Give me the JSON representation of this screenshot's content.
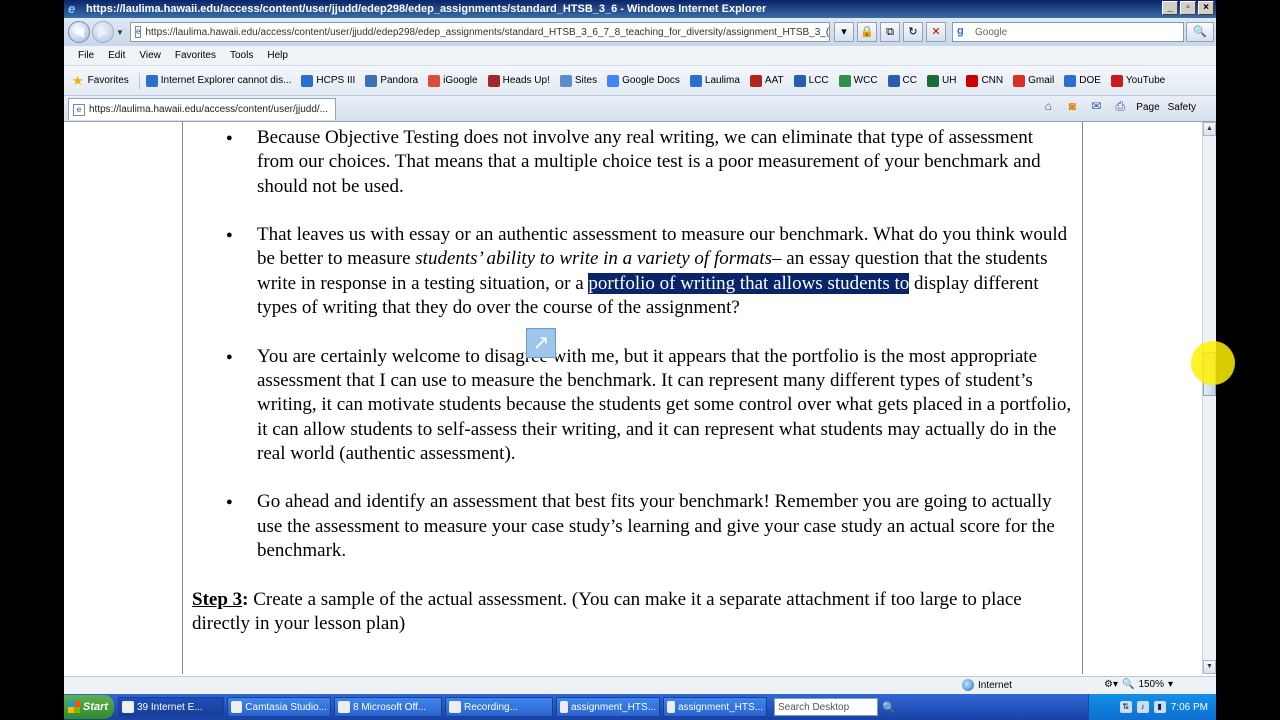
{
  "window": {
    "title": "https://laulima.hawaii.edu/access/content/user/jjudd/edep298/edep_assignments/standard_HTSB_3_6 - Windows Internet Explorer"
  },
  "address_bar": {
    "url": "https://laulima.hawaii.edu/access/content/user/jjudd/edep298/edep_assignments/standard_HTSB_3_6_7_8_teaching_for_diversity/assignment_HTSB_3_("
  },
  "search": {
    "placeholder": "Google"
  },
  "menu": [
    "File",
    "Edit",
    "View",
    "Favorites",
    "Tools",
    "Help"
  ],
  "favorites_bar": {
    "favorites_label": "Favorites",
    "items": [
      {
        "label": "Internet Explorer cannot dis...",
        "icon": "ie-page-icon",
        "color": "#2a6fcf"
      },
      {
        "label": "HCPS III",
        "icon": "ie-page-icon",
        "color": "#2a6fcf"
      },
      {
        "label": "Pandora",
        "icon": "pandora-icon",
        "color": "#3b6fb6"
      },
      {
        "label": "iGoogle",
        "icon": "google-icon",
        "color": "#dd4b39"
      },
      {
        "label": "Heads Up!",
        "icon": "headsup-icon",
        "color": "#a3262a"
      },
      {
        "label": "Sites",
        "icon": "sites-icon",
        "color": "#5b8bd0"
      },
      {
        "label": "Google Docs",
        "icon": "docs-icon",
        "color": "#4285f4"
      },
      {
        "label": "Laulima",
        "icon": "ie-page-icon",
        "color": "#2a6fcf"
      },
      {
        "label": "AAT",
        "icon": "aat-icon",
        "color": "#b3261e"
      },
      {
        "label": "LCC",
        "icon": "lcc-icon",
        "color": "#2a5db0"
      },
      {
        "label": "WCC",
        "icon": "wcc-icon",
        "color": "#2f8f46"
      },
      {
        "label": "CC",
        "icon": "cc-icon",
        "color": "#2a5db0"
      },
      {
        "label": "UH",
        "icon": "uh-icon",
        "color": "#1b6b3a"
      },
      {
        "label": "CNN",
        "icon": "cnn-icon",
        "color": "#cc0000"
      },
      {
        "label": "Gmail",
        "icon": "gmail-icon",
        "color": "#d93025"
      },
      {
        "label": "DOE",
        "icon": "ie-page-icon",
        "color": "#2a6fcf"
      },
      {
        "label": "YouTube",
        "icon": "youtube-icon",
        "color": "#cc181e"
      }
    ]
  },
  "tab": {
    "label": "https://laulima.hawaii.edu/access/content/user/jjudd/..."
  },
  "command_bar": {
    "page_label": "Page",
    "safety_label": "Safety"
  },
  "document": {
    "bullet1": "Because Objective Testing does not involve any real writing, we can eliminate that type of assessment from our choices. That means that a multiple choice test is a poor measurement of your benchmark and should not be used.",
    "bullet2_pre": "That leaves us with essay or an authentic assessment to measure our benchmark. What do you think would be better to measure ",
    "bullet2_italic": "students’ ability to write in a variety of formats",
    "bullet2_mid": "– an essay question that the students write in response in a testing situation, or a",
    "bullet2_highlight": "portfolio of writing that allows students to",
    "bullet2_post": " display different types of writing that they do over the course of the assignment?",
    "bullet3": "You are certainly welcome to disagree with me, but it appears that the portfolio is the most appropriate assessment that I can use to measure the benchmark.  It can represent many different types of student’s writing, it can motivate students because the students get some control over what gets placed in a portfolio, it can allow students to self-assess their writing, and it can represent what students may actually do in the real world (authentic assessment).",
    "bullet4": "Go ahead and identify an assessment that best fits your benchmark! Remember you are going to actually use the assessment to measure your case  study’s learning and give your case study an actual score for the benchmark.",
    "step_label": "Step 3",
    "step_colon": ":",
    "step_text": " Create a sample of the actual assessment. (You can make it a separate attachment if too large to place directly in your lesson plan)"
  },
  "status_bar": {
    "zone": "Internet",
    "zoom": "150%"
  },
  "taskbar": {
    "start_label": "Start",
    "buttons": [
      {
        "label": "39 Internet E..."
      },
      {
        "label": "Camtasia Studio..."
      },
      {
        "label": "8 Microsoft Off..."
      },
      {
        "label": "Recording..."
      },
      {
        "label": "assignment_HTS..."
      },
      {
        "label": "assignment_HTS..."
      }
    ],
    "search_placeholder": "Search Desktop",
    "clock": "7:06 PM"
  }
}
